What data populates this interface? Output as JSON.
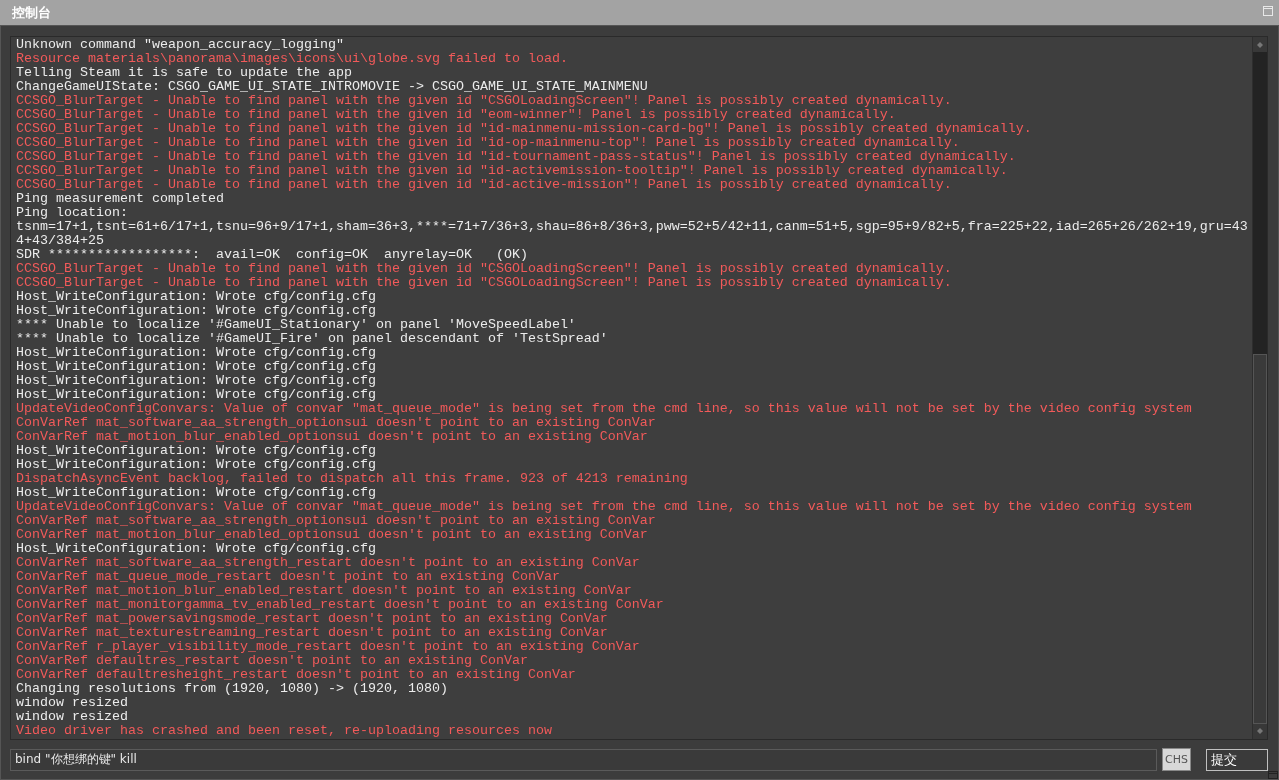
{
  "window": {
    "title": "控制台"
  },
  "log": [
    {
      "kind": "info",
      "text": "Unknown command \"weapon_accuracy_logging\""
    },
    {
      "kind": "error",
      "text": "Resource materials\\panorama\\images\\icons\\ui\\globe.svg failed to load."
    },
    {
      "kind": "info",
      "text": "Telling Steam it is safe to update the app"
    },
    {
      "kind": "info",
      "text": "ChangeGameUIState: CSGO_GAME_UI_STATE_INTROMOVIE -> CSGO_GAME_UI_STATE_MAINMENU"
    },
    {
      "kind": "error",
      "text": "CCSGO_BlurTarget - Unable to find panel with the given id \"CSGOLoadingScreen\"! Panel is possibly created dynamically."
    },
    {
      "kind": "error",
      "text": "CCSGO_BlurTarget - Unable to find panel with the given id \"eom-winner\"! Panel is possibly created dynamically."
    },
    {
      "kind": "error",
      "text": "CCSGO_BlurTarget - Unable to find panel with the given id \"id-mainmenu-mission-card-bg\"! Panel is possibly created dynamically."
    },
    {
      "kind": "error",
      "text": "CCSGO_BlurTarget - Unable to find panel with the given id \"id-op-mainmenu-top\"! Panel is possibly created dynamically."
    },
    {
      "kind": "error",
      "text": "CCSGO_BlurTarget - Unable to find panel with the given id \"id-tournament-pass-status\"! Panel is possibly created dynamically."
    },
    {
      "kind": "error",
      "text": "CCSGO_BlurTarget - Unable to find panel with the given id \"id-activemission-tooltip\"! Panel is possibly created dynamically."
    },
    {
      "kind": "error",
      "text": "CCSGO_BlurTarget - Unable to find panel with the given id \"id-active-mission\"! Panel is possibly created dynamically."
    },
    {
      "kind": "info",
      "text": "Ping measurement completed"
    },
    {
      "kind": "info",
      "text": "Ping location:"
    },
    {
      "kind": "info",
      "text": "tsnm=17+1,tsnt=61+6/17+1,tsnu=96+9/17+1,sham=36+3,****=71+7/36+3,shau=86+8/36+3,pww=52+5/42+11,canm=51+5,sgp=95+9/82+5,fra=225+22,iad=265+26/262+19,gru=434+43/384+25"
    },
    {
      "kind": "info",
      "text": "SDR ******************:  avail=OK  config=OK  anyrelay=OK   (OK)"
    },
    {
      "kind": "error",
      "text": "CCSGO_BlurTarget - Unable to find panel with the given id \"CSGOLoadingScreen\"! Panel is possibly created dynamically."
    },
    {
      "kind": "error",
      "text": "CCSGO_BlurTarget - Unable to find panel with the given id \"CSGOLoadingScreen\"! Panel is possibly created dynamically."
    },
    {
      "kind": "info",
      "text": "Host_WriteConfiguration: Wrote cfg/config.cfg"
    },
    {
      "kind": "info",
      "text": "Host_WriteConfiguration: Wrote cfg/config.cfg"
    },
    {
      "kind": "info",
      "text": "**** Unable to localize '#GameUI_Stationary' on panel 'MoveSpeedLabel'"
    },
    {
      "kind": "info",
      "text": "**** Unable to localize '#GameUI_Fire' on panel descendant of 'TestSpread'"
    },
    {
      "kind": "info",
      "text": "Host_WriteConfiguration: Wrote cfg/config.cfg"
    },
    {
      "kind": "info",
      "text": "Host_WriteConfiguration: Wrote cfg/config.cfg"
    },
    {
      "kind": "info",
      "text": "Host_WriteConfiguration: Wrote cfg/config.cfg"
    },
    {
      "kind": "info",
      "text": "Host_WriteConfiguration: Wrote cfg/config.cfg"
    },
    {
      "kind": "error",
      "text": "UpdateVideoConfigConvars: Value of convar \"mat_queue_mode\" is being set from the cmd line, so this value will not be set by the video config system"
    },
    {
      "kind": "error",
      "text": "ConVarRef mat_software_aa_strength_optionsui doesn't point to an existing ConVar"
    },
    {
      "kind": "error",
      "text": "ConVarRef mat_motion_blur_enabled_optionsui doesn't point to an existing ConVar"
    },
    {
      "kind": "info",
      "text": "Host_WriteConfiguration: Wrote cfg/config.cfg"
    },
    {
      "kind": "info",
      "text": "Host_WriteConfiguration: Wrote cfg/config.cfg"
    },
    {
      "kind": "error",
      "text": "DispatchAsyncEvent backlog, failed to dispatch all this frame. 923 of 4213 remaining"
    },
    {
      "kind": "info",
      "text": "Host_WriteConfiguration: Wrote cfg/config.cfg"
    },
    {
      "kind": "error",
      "text": "UpdateVideoConfigConvars: Value of convar \"mat_queue_mode\" is being set from the cmd line, so this value will not be set by the video config system"
    },
    {
      "kind": "error",
      "text": "ConVarRef mat_software_aa_strength_optionsui doesn't point to an existing ConVar"
    },
    {
      "kind": "error",
      "text": "ConVarRef mat_motion_blur_enabled_optionsui doesn't point to an existing ConVar"
    },
    {
      "kind": "info",
      "text": "Host_WriteConfiguration: Wrote cfg/config.cfg"
    },
    {
      "kind": "error",
      "text": "ConVarRef mat_software_aa_strength_restart doesn't point to an existing ConVar"
    },
    {
      "kind": "error",
      "text": "ConVarRef mat_queue_mode_restart doesn't point to an existing ConVar"
    },
    {
      "kind": "error",
      "text": "ConVarRef mat_motion_blur_enabled_restart doesn't point to an existing ConVar"
    },
    {
      "kind": "error",
      "text": "ConVarRef mat_monitorgamma_tv_enabled_restart doesn't point to an existing ConVar"
    },
    {
      "kind": "error",
      "text": "ConVarRef mat_powersavingsmode_restart doesn't point to an existing ConVar"
    },
    {
      "kind": "error",
      "text": "ConVarRef mat_texturestreaming_restart doesn't point to an existing ConVar"
    },
    {
      "kind": "error",
      "text": "ConVarRef r_player_visibility_mode_restart doesn't point to an existing ConVar"
    },
    {
      "kind": "error",
      "text": "ConVarRef defaultres_restart doesn't point to an existing ConVar"
    },
    {
      "kind": "error",
      "text": "ConVarRef defaultresheight_restart doesn't point to an existing ConVar"
    },
    {
      "kind": "info",
      "text": "Changing resolutions from (1920, 1080) -> (1920, 1080)"
    },
    {
      "kind": "info",
      "text": "window resized"
    },
    {
      "kind": "info",
      "text": "window resized"
    },
    {
      "kind": "error",
      "text": "Video driver has crashed and been reset, re-uploading resources now"
    }
  ],
  "command_input": {
    "value": "bind \"你想绑的键\" kill"
  },
  "ime_indicator": "CHS",
  "submit_button": "提交"
}
